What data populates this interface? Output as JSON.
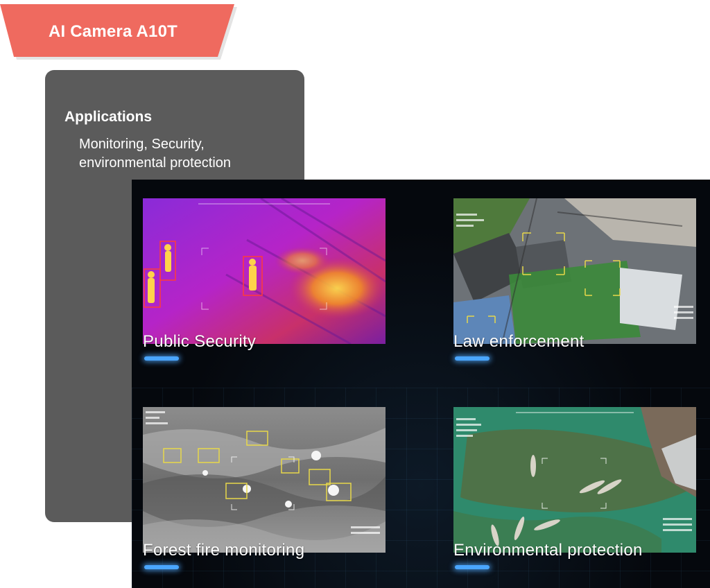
{
  "banner": {
    "title": "AI Camera A10T",
    "color": "#ef6a5f"
  },
  "info": {
    "heading": "Applications",
    "body": "Monitoring, Security, environmental protection"
  },
  "applications": [
    {
      "label": "Public Security",
      "icon": "thermal-image"
    },
    {
      "label": "Law enforcement",
      "icon": "aerial-city-image"
    },
    {
      "label": "Forest fire monitoring",
      "icon": "thermal-terrain-image"
    },
    {
      "label": "Environmental protection",
      "icon": "aerial-river-image"
    }
  ],
  "accent_color": "#4aa6ff"
}
